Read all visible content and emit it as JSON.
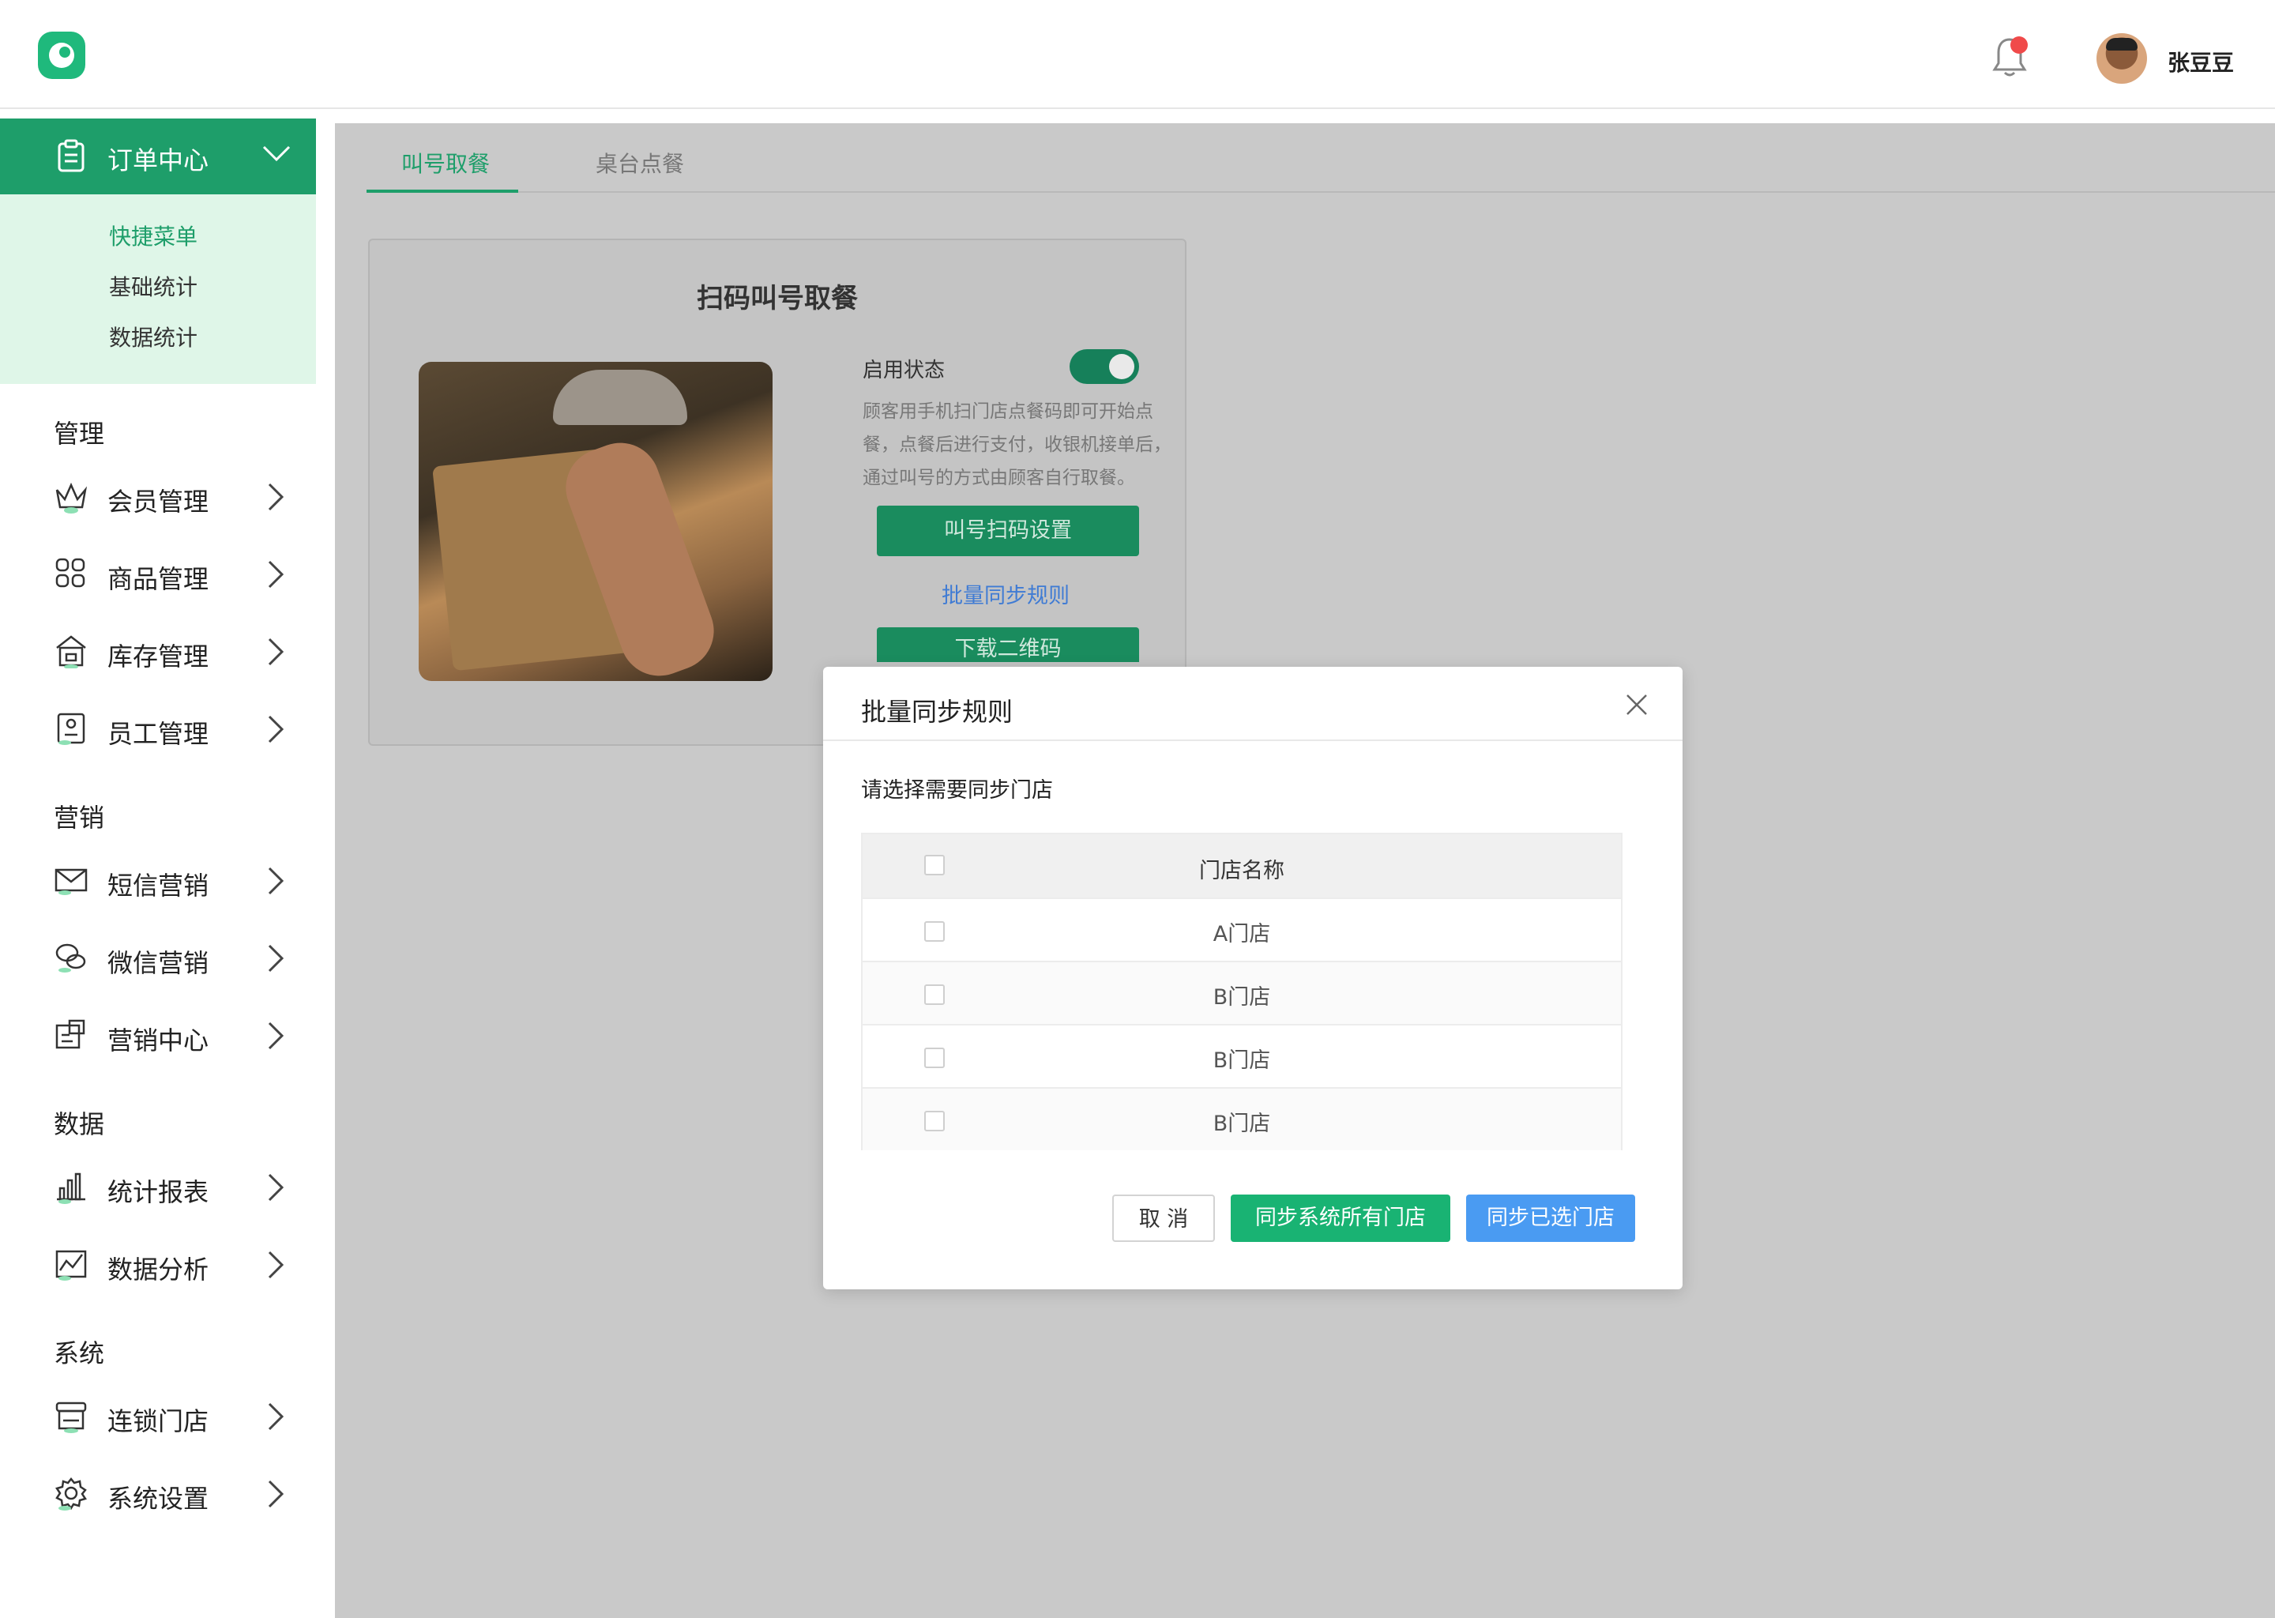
{
  "header": {
    "username": "张豆豆"
  },
  "sidebar": {
    "order_center": "订单中心",
    "submenu": [
      "快捷菜单",
      "基础统计",
      "数据统计"
    ],
    "sections": {
      "manage": {
        "title": "管理",
        "items": [
          "会员管理",
          "商品管理",
          "库存管理",
          "员工管理"
        ]
      },
      "marketing": {
        "title": "营销",
        "items": [
          "短信营销",
          "微信营销",
          "营销中心"
        ]
      },
      "data": {
        "title": "数据",
        "items": [
          "统计报表",
          "数据分析"
        ]
      },
      "system": {
        "title": "系统",
        "items": [
          "连锁门店",
          "系统设置"
        ]
      }
    }
  },
  "tabs": [
    "叫号取餐",
    "桌台点餐"
  ],
  "card": {
    "title": "扫码叫号取餐",
    "toggle_label": "启用状态",
    "description": "顾客用手机扫门店点餐码即可开始点餐，点餐后进行支付，收银机接单后，通过叫号的方式由顾客自行取餐。",
    "btn_settings": "叫号扫码设置",
    "link_batch": "批量同步规则",
    "btn_download": "下载二维码"
  },
  "modal": {
    "title": "批量同步规则",
    "prompt": "请选择需要同步门店",
    "column": "门店名称",
    "rows": [
      "A门店",
      "B门店",
      "B门店",
      "B门店"
    ],
    "cancel": "取 消",
    "sync_all": "同步系统所有门店",
    "sync_selected": "同步已选门店"
  },
  "colors": {
    "brand_green": "#1e9e6a",
    "primary_blue": "#4a9bf2"
  }
}
